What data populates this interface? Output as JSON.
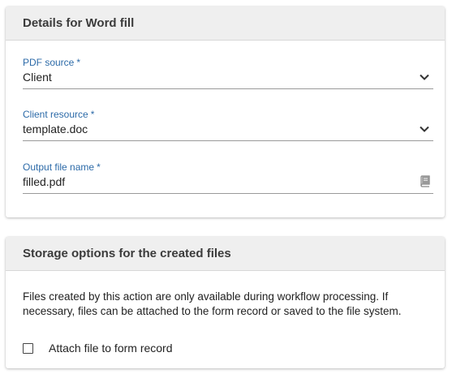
{
  "details": {
    "title": "Details for Word fill",
    "required_marker": "*",
    "fields": [
      {
        "label": "PDF source",
        "value": "Client",
        "control": "chevron-down-icon"
      },
      {
        "label": "Client resource",
        "value": "template.doc",
        "control": "chevron-down-icon"
      },
      {
        "label": "Output file name",
        "value": "filled.pdf",
        "control": "book-icon"
      }
    ]
  },
  "storage": {
    "title": "Storage options for the created files",
    "info": "Files created by this action are only available during workflow processing. If necessary, files can be attached to the form record or saved to the file system.",
    "checkbox_label": "Attach file to form record",
    "checkbox_checked": false
  },
  "colors": {
    "label": "#2c6aa8",
    "header_bg": "#efefef",
    "underline": "#9a9a9a"
  }
}
